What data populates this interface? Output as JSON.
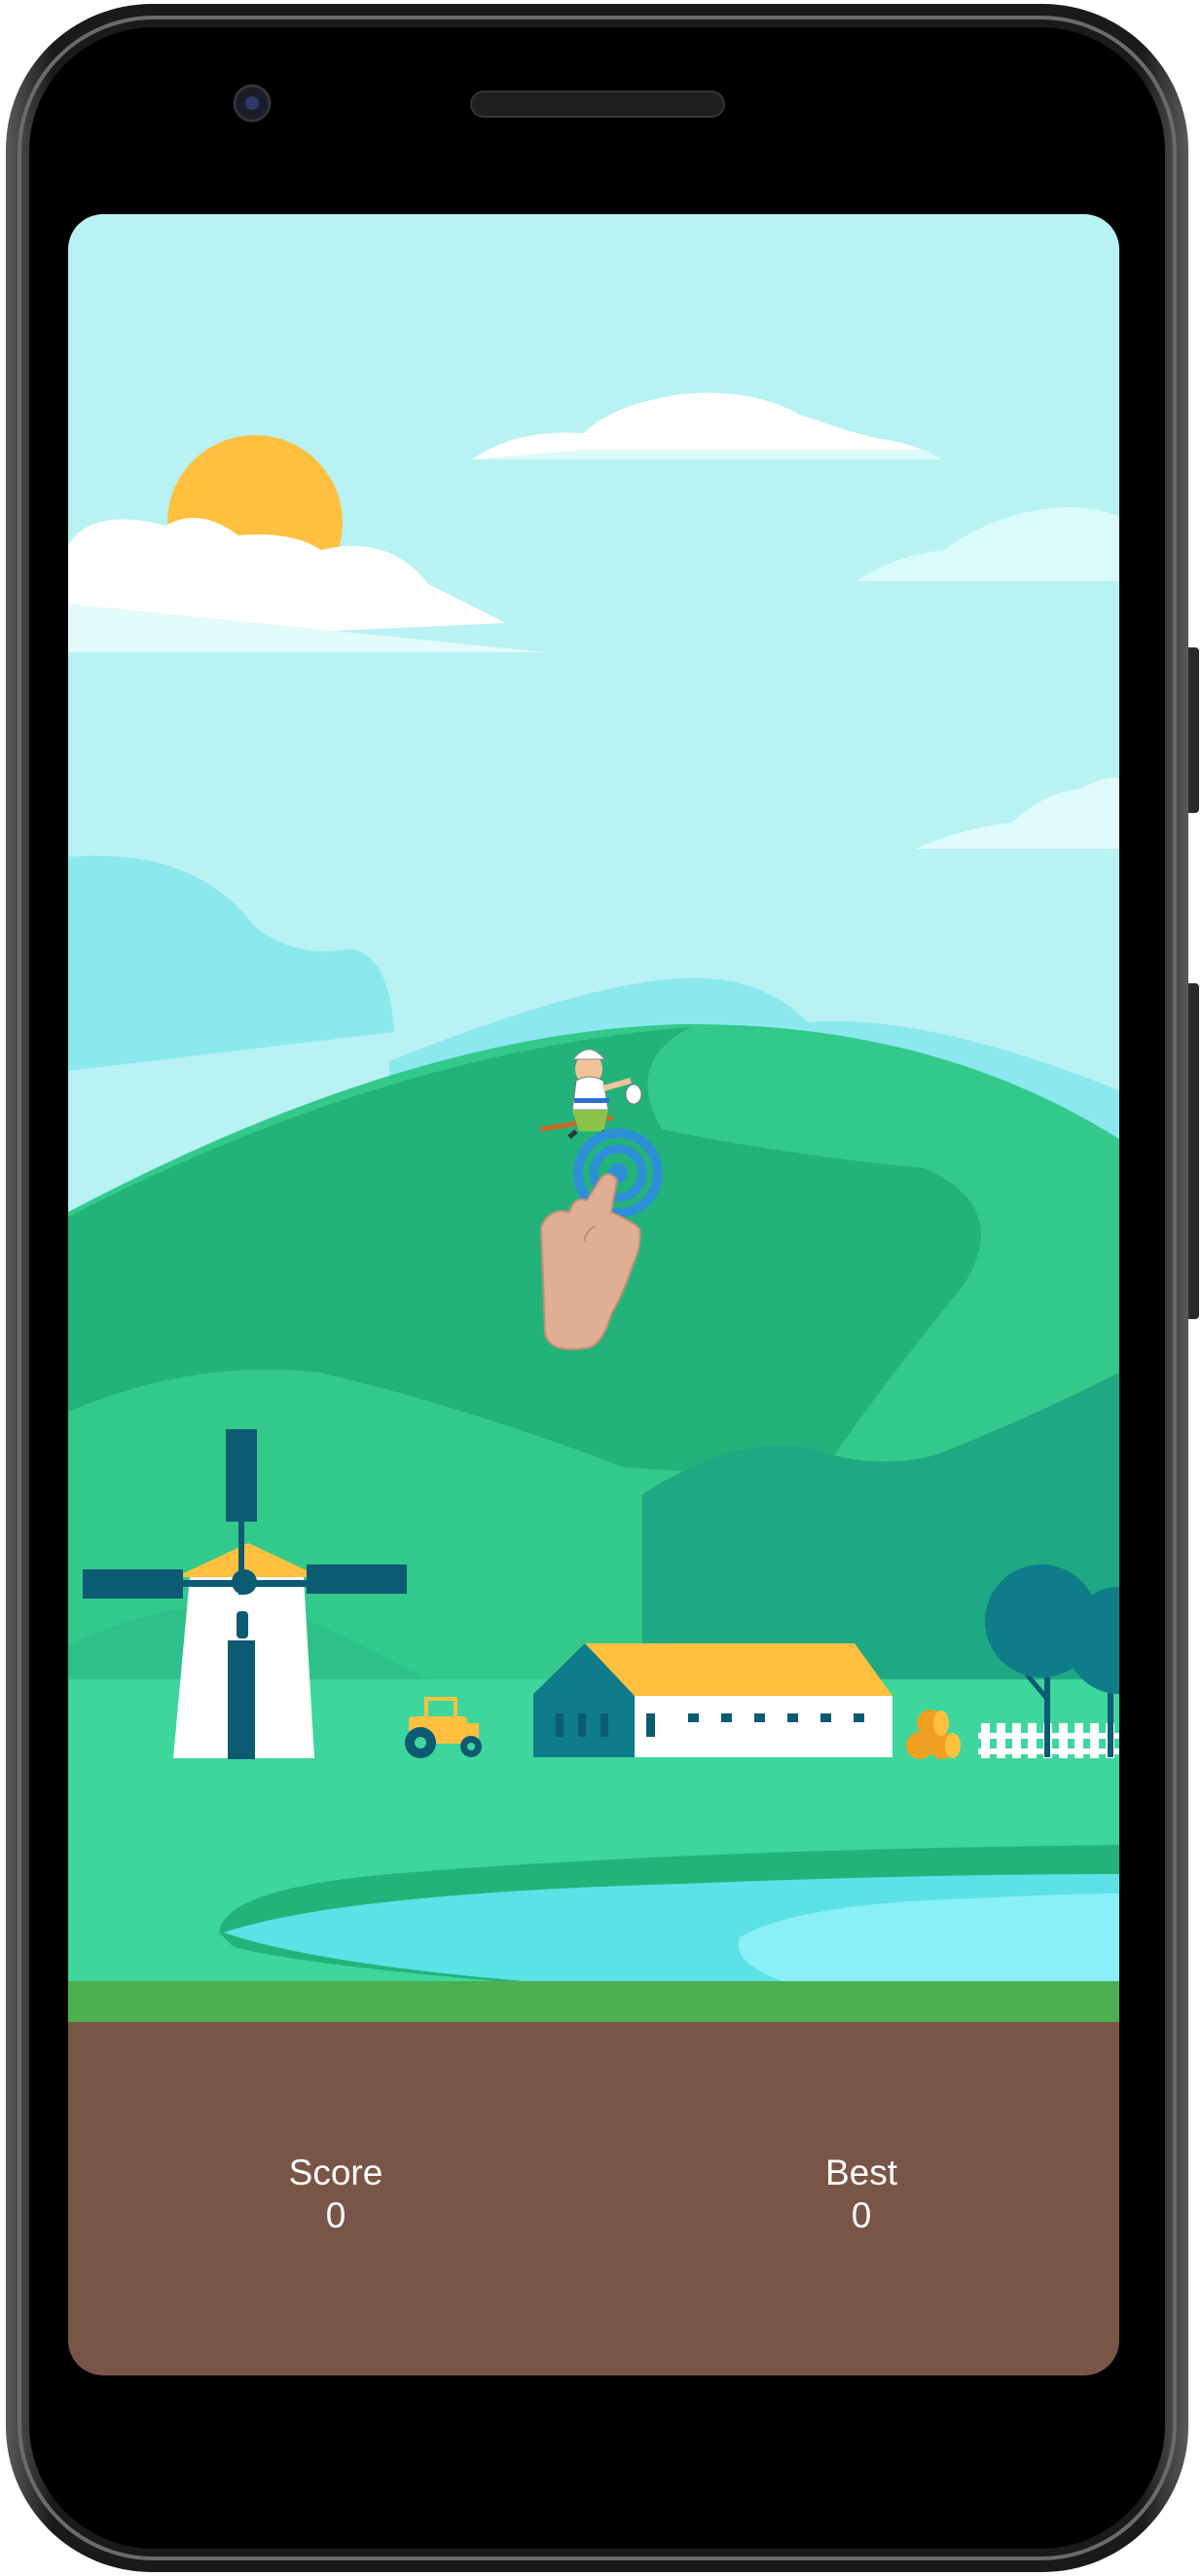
{
  "game": {
    "hud": {
      "score_label": "Score",
      "score_value": "0",
      "best_label": "Best",
      "best_value": "0"
    },
    "tutorial_hint": {
      "icon": "tap-hand-icon"
    },
    "player": {
      "icon": "farmer-character-icon"
    }
  },
  "colors": {
    "sky": "#b8f2f3",
    "hill_light": "#33c98b",
    "hill_dark": "#23b37a",
    "ground_grass": "#3dd69c",
    "pond": "#5ce1e6",
    "grass_strip": "#4caf50",
    "soil": "#795548",
    "sun": "#fec03e",
    "barn_roof": "#fec03e",
    "accent_teal": "#0d5a73"
  }
}
